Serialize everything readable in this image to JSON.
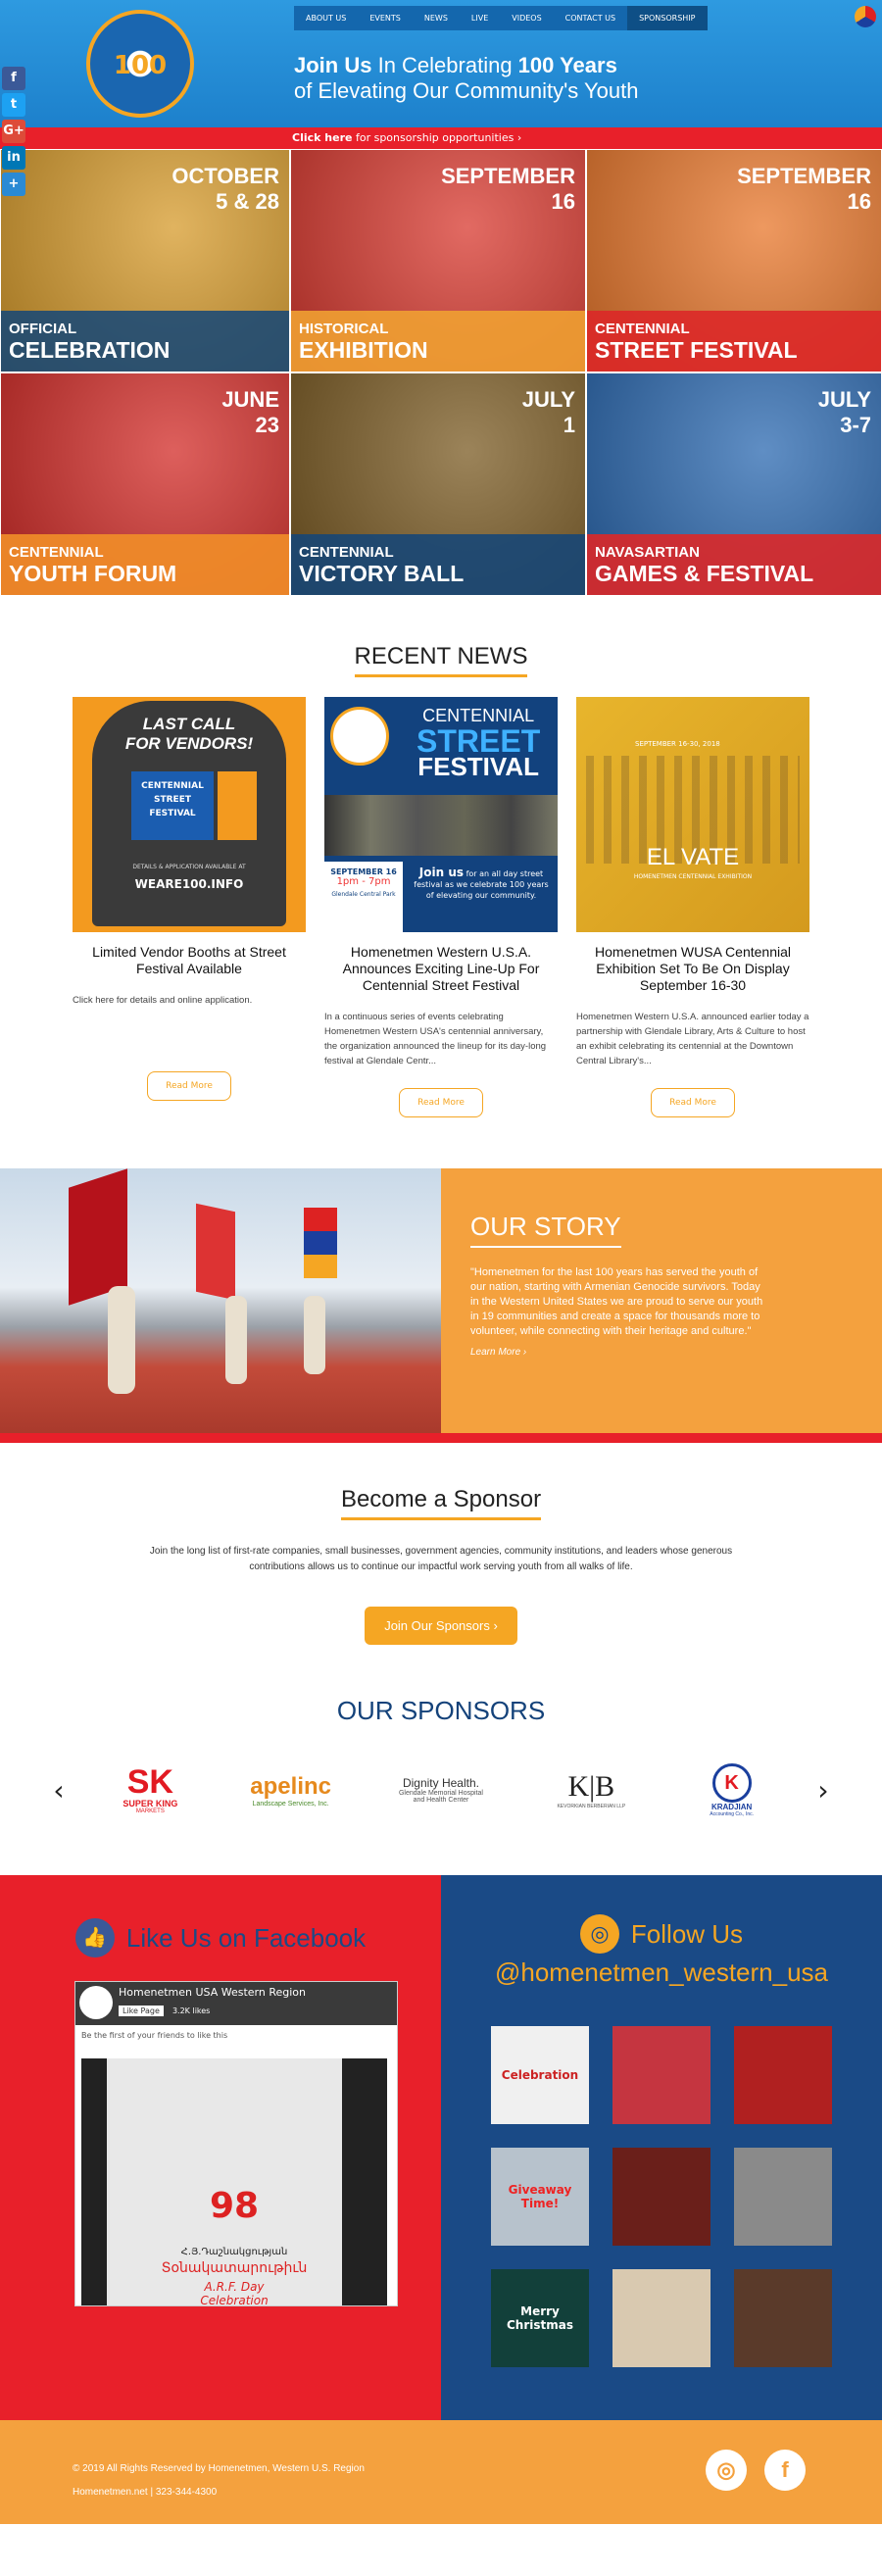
{
  "header": {
    "logo_text": "100",
    "nav": [
      "ABOUT US",
      "EVENTS",
      "NEWS",
      "LIVE",
      "VIDEOS",
      "CONTACT US",
      "SPONSORSHIP"
    ],
    "hero_join": "Join Us",
    "hero_rest1": " In Celebrating ",
    "hero_bold": "100 Years",
    "hero_line2": "of Elevating Our Community's Youth",
    "bar_link": "Click here",
    "bar_rest": " for sponsorship opportunities ›"
  },
  "share": [
    {
      "icon": "facebook-icon",
      "glyph": "f",
      "color": "#3b5998"
    },
    {
      "icon": "twitter-icon",
      "glyph": "t",
      "color": "#1da1f2"
    },
    {
      "icon": "google-plus-icon",
      "glyph": "G+",
      "color": "#dd4b39"
    },
    {
      "icon": "linkedin-icon",
      "glyph": "in",
      "color": "#0077b5"
    },
    {
      "icon": "share-plus-icon",
      "glyph": "+",
      "color": "#2a8ad4"
    }
  ],
  "tiles": [
    {
      "month": "OCTOBER",
      "day": "5 & 28",
      "l1": "OFFICIAL",
      "l2": "CELEBRATION",
      "bg": "#d69a2a",
      "cap": "rgba(20,70,120,0.85)"
    },
    {
      "month": "SEPTEMBER",
      "day": "16",
      "l1": "HISTORICAL",
      "l2": "EXHIBITION",
      "bg": "#d8382e",
      "cap": "rgba(240,160,50,0.9)"
    },
    {
      "month": "SEPTEMBER",
      "day": "16",
      "l1": "CENTENNIAL",
      "l2": "STREET FESTIVAL",
      "bg": "#e8762a",
      "cap": "rgba(220,40,40,0.9)"
    },
    {
      "month": "JUNE",
      "day": "23",
      "l1": "CENTENNIAL",
      "l2": "YOUTH FORUM",
      "bg": "#d22a26",
      "cap": "rgba(240,140,40,0.92)"
    },
    {
      "month": "JULY",
      "day": "1",
      "l1": "CENTENNIAL",
      "l2": "VICTORY BALL",
      "bg": "#7a5a22",
      "cap": "rgba(20,70,120,0.88)"
    },
    {
      "month": "JULY",
      "day": "3-7",
      "l1": "NAVASARTIAN",
      "l2": "GAMES & FESTIVAL",
      "bg": "#2a68b0",
      "cap": "rgba(220,40,40,0.9)"
    }
  ],
  "news": {
    "title": "RECENT NEWS",
    "cards": [
      {
        "img_top": "LAST CALL",
        "img_top2": "FOR VENDORS!",
        "img_inner1": "CENTENNIAL",
        "img_inner2": "STREET",
        "img_inner3": "FESTIVAL",
        "img_small": "DETAILS & APPLICATION AVAILABLE AT",
        "img_url": "WEARE100.INFO",
        "title": "Limited Vendor Booths at Street Festival Available",
        "body": "Click here for details and online application.",
        "btn": "Read More"
      },
      {
        "img_t1": "CENTENNIAL",
        "img_t2": "STREET",
        "img_t3": "FESTIVAL",
        "img_date": "SEPTEMBER 16",
        "img_time": "1pm - 7pm",
        "img_join": "Join us",
        "img_join_rest": " for an all day street festival as we celebrate 100 years of elevating our community.",
        "img_loc": "Glendale Central Park",
        "title": "Homenetmen Western U.S.A. Announces Exciting Line-Up For Centennial Street Festival",
        "body": "In a continuous series of events celebrating Homenetmen Western USA's centennial anniversary, the organization announced the lineup for its day-long festival at Glendale Centr...",
        "btn": "Read More"
      },
      {
        "img_date": "SEPTEMBER 16-30, 2018",
        "img_word": "EL VATE",
        "img_sub": "HOMENETMEN CENTENNIAL EXHIBITION",
        "title": "Homenetmen WUSA Centennial Exhibition Set To Be On Display September 16-30",
        "body": "Homenetmen Western U.S.A. announced earlier today a partnership with Glendale Library, Arts & Culture to host an exhibit celebrating its centennial at the Downtown Central Library's...",
        "btn": "Read More"
      }
    ]
  },
  "story": {
    "title": "OUR STORY",
    "quote": "\"Homenetmen for the last 100 years has served the youth of our nation, starting with Armenian Genocide survivors. Today in the Western United States we are proud to serve our youth in 19 communities and create a space for thousands more to volunteer, while connecting with their heritage and culture.\"",
    "learn": "Learn More ›"
  },
  "sponsor": {
    "title": "Become a Sponsor",
    "text": "Join the long list of first-rate companies, small businesses, government agencies, community institutions, and leaders whose generous contributions allows us to continue our impactful work serving youth from all walks of life.",
    "btn": "Join Our Sponsors  ›",
    "sponsors_title": "OUR SPONSORS",
    "logos": [
      {
        "t1": "SK",
        "t2": "SUPER KING",
        "t3": "MARKETS"
      },
      {
        "t1": "apelinc",
        "t2": "Landscape Services, Inc."
      },
      {
        "t1": "Dignity Health.",
        "t2": "Glendale Memorial Hospital",
        "t3": "and Health Center"
      },
      {
        "t1": "K|B",
        "t2": "KEVORKIAN BERBERIAN LLP"
      },
      {
        "t1": "K",
        "t2": "KRADJIAN",
        "t3": "Accounting Co., Inc."
      }
    ]
  },
  "facebook": {
    "title": "Like Us on Facebook",
    "page": "Homenetmen USA Western Region",
    "like": "Like Page",
    "likes": "3.2K likes",
    "friends": "Be the first of your friends to like this",
    "post_num": "98",
    "post_line1": "Հ.Յ.Դաշնակցության",
    "post_line2": "Տօնակատարութիւն",
    "post_line3": "A.R.F. Day",
    "post_line4": "Celebration"
  },
  "instagram": {
    "title": "Follow Us",
    "handle": "@homenetmen_western_usa",
    "photos": [
      {
        "bg": "#f0f0f0",
        "text": "Celebration",
        "fg": "#c22"
      },
      {
        "bg": "#c53540",
        "text": "",
        "fg": "#fff"
      },
      {
        "bg": "#b02020",
        "text": "",
        "fg": "#fff"
      },
      {
        "bg": "#b7c2cc",
        "text": "Giveaway Time!",
        "fg": "#e22"
      },
      {
        "bg": "#6a1f1a",
        "text": "",
        "fg": "#fff"
      },
      {
        "bg": "#8a8a8a",
        "text": "",
        "fg": "#fff"
      },
      {
        "bg": "#12403a",
        "text": "Merry Christmas",
        "fg": "#fff"
      },
      {
        "bg": "#d9c9b0",
        "text": "",
        "fg": "#222"
      },
      {
        "bg": "#5a3a2a",
        "text": "",
        "fg": "#fff"
      }
    ]
  },
  "footer": {
    "copy": "© 2019 All Rights Reserved by Homenetmen, Western U.S. Region",
    "contact": "Homenetmen.net | 323-344-4300",
    "ig": "◎",
    "fb": "f"
  }
}
